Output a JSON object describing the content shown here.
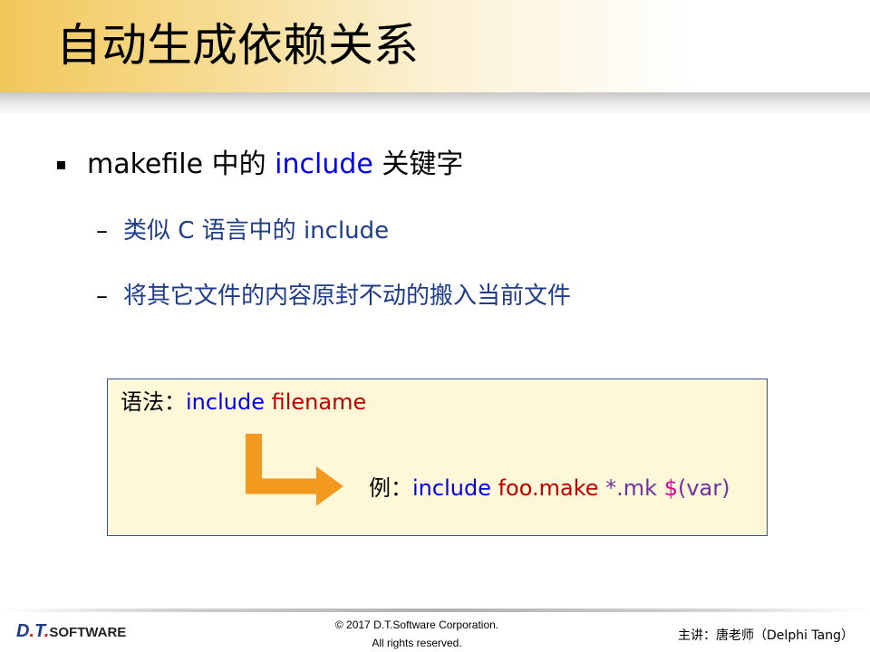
{
  "slide": {
    "title": "自动生成依赖关系",
    "bullet": {
      "prefix": "makefile 中的 ",
      "keyword": "include",
      "suffix": " 关键字"
    },
    "sub_items": [
      {
        "dash": "–",
        "text": "类似 C 语言中的 include"
      },
      {
        "dash": "–",
        "text": "将其它文件的内容原封不动的搬入当前文件"
      }
    ],
    "syntax_box": {
      "label": "语法：",
      "keyword": "include",
      "arg": "filename",
      "example_label": "例：",
      "example_keyword": "include",
      "example_arg1": "foo.make",
      "example_arg2": "*.mk",
      "example_arg3_dollar": "$",
      "example_arg3_rest": "(var)"
    }
  },
  "footer": {
    "logo_letters": "D",
    "logo_dot1": ".",
    "logo_t": "T",
    "logo_dot2": ".",
    "logo_rest": "SOFTWARE",
    "copyright_line1": "© 2017 D.T.Software Corporation.",
    "copyright_line2": "All rights reserved.",
    "speaker": "主讲：唐老师（Delphi Tang）"
  },
  "colors": {
    "keyword_blue": "#0000ee",
    "arg_red": "#c00000",
    "sub_text": "#1f3c8a",
    "box_bg": "#fff8d8",
    "arrow_orange": "#f39a1e"
  }
}
